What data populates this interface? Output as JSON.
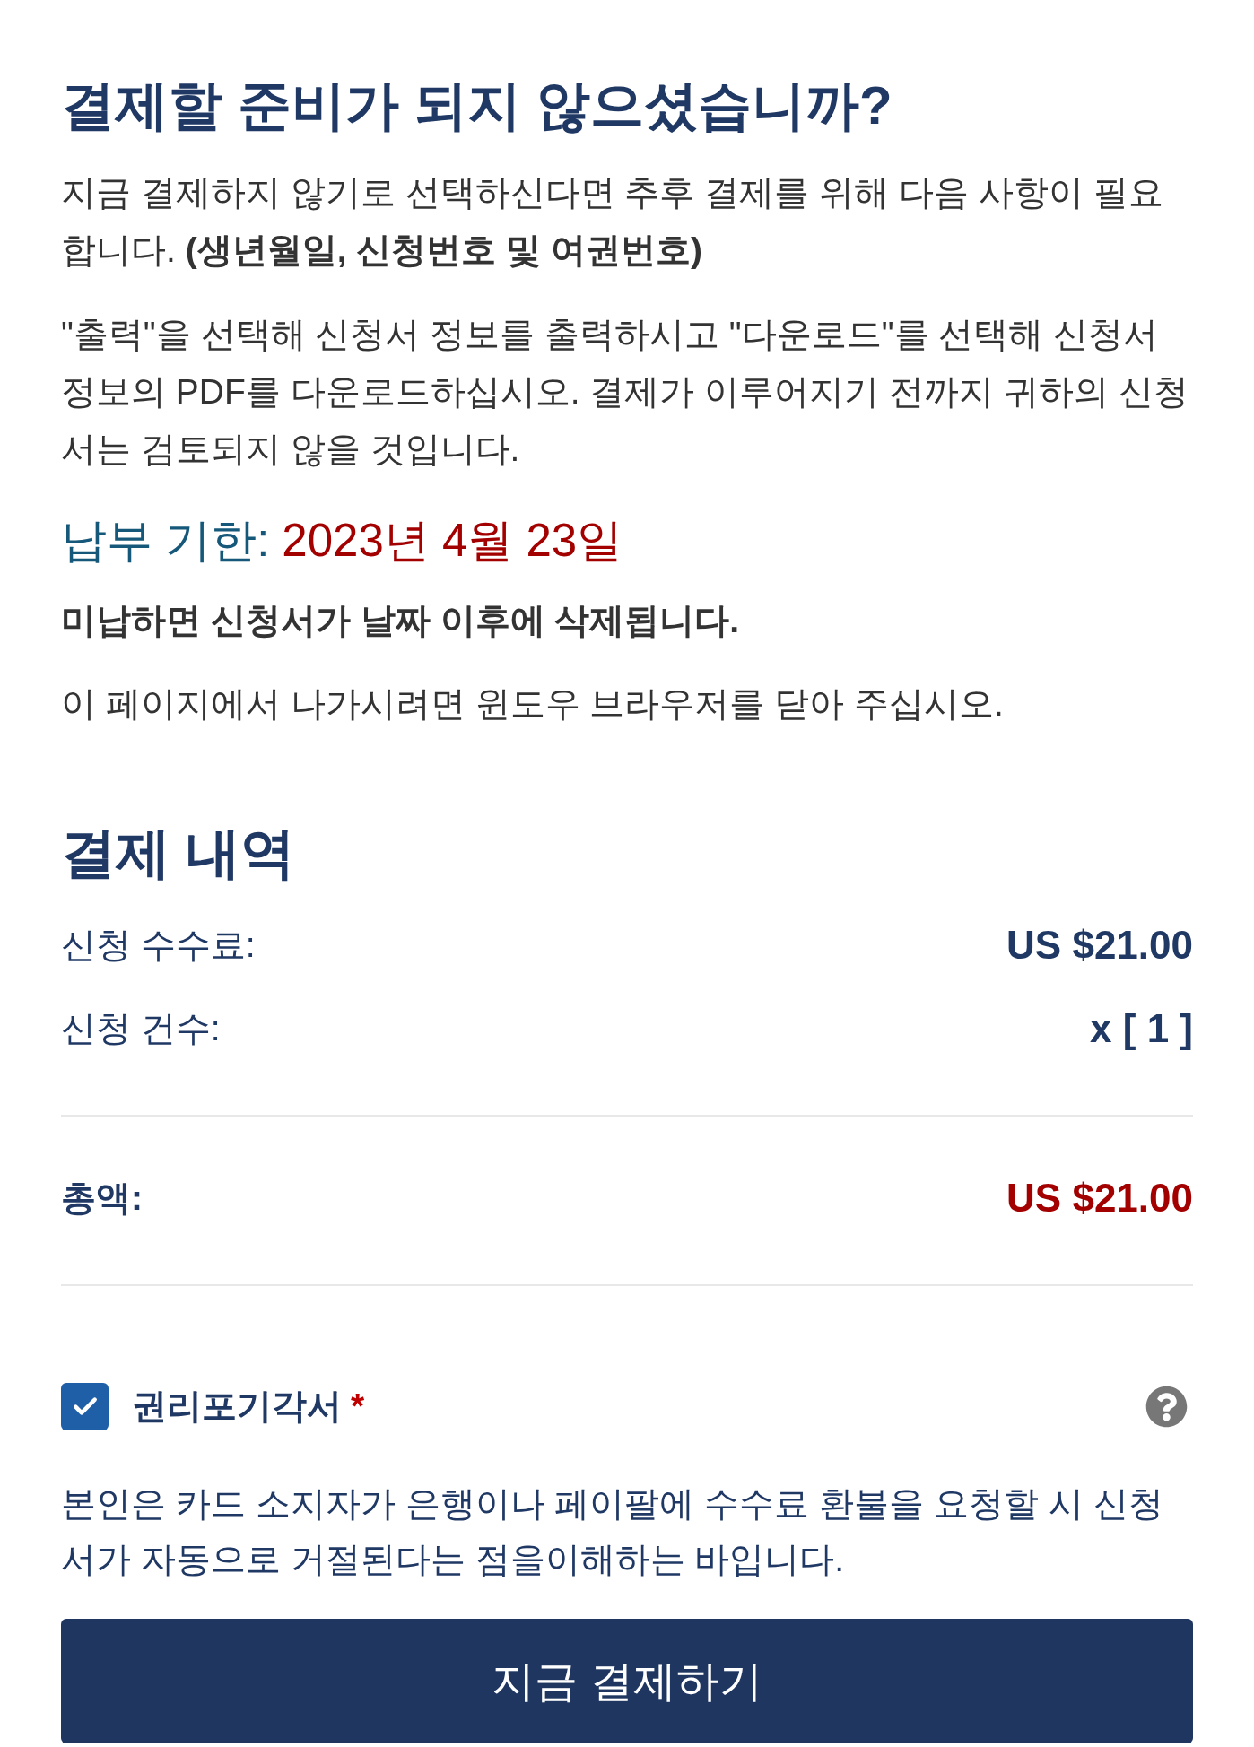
{
  "notice": {
    "title": "결제할 준비가 되지 않으셨습니까?",
    "paragraphs": [
      "지금 결제하지 않기로 선택하신다면 추후 결제를 위해 다음 사항이 필요합니다. **(생년월일, 신청번호 및 여권번호)**",
      "\"출력\"을 선택해 신청서 정보를 출력하시고 \"다운로드\"를 선택해 신청서 정보의 PDF를 다운로드하십시오. 결제가 이루어지기 전까지 귀하의 신청서는 검토되지 않을 것입니다."
    ]
  },
  "due": {
    "label": "납부 기한:",
    "date": "2023년 4월 23일"
  },
  "warning": "미납하면 신청서가 날짜 이후에 삭제됩니다.",
  "exit_note": "이 페이지에서 나가시려면 윈도우 브라우저를 닫아 주십시오.",
  "summary": {
    "title": "결제 내역",
    "rows": [
      {
        "kind": "line",
        "label": "신청 수수료:",
        "value": "US $21.00"
      },
      {
        "kind": "line",
        "label": "신청 건수:",
        "value": "x [ 1 ]"
      },
      {
        "kind": "total",
        "label": "총액:",
        "value": "US $21.00"
      }
    ]
  },
  "waiver": {
    "label": "권리포기각서",
    "required_mark": "*",
    "checked": true,
    "text": "본인은 카드 소지자가 은행이나 페이팔에 수수료 환불을 요청할 시 신청서가 자동으로 거절된다는 점을이해하는 바입니다."
  },
  "pay_button": "지금 결제하기"
}
